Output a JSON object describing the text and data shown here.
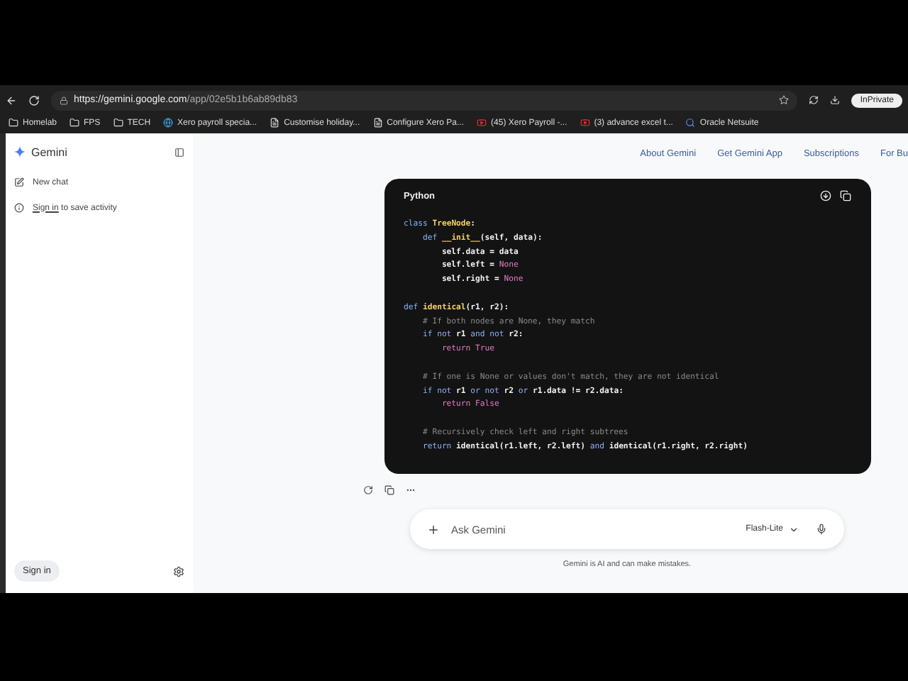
{
  "browser": {
    "url_host": "https://gemini.google.com",
    "url_path": "/app/02e5b1b6ab89db83",
    "profile": "InPrivate",
    "bookmarks": [
      {
        "label": "Homelab",
        "kind": "folder"
      },
      {
        "label": "FPS",
        "kind": "folder"
      },
      {
        "label": "TECH",
        "kind": "folder"
      },
      {
        "label": "Xero payroll specia...",
        "kind": "globe"
      },
      {
        "label": "Customise holiday...",
        "kind": "page"
      },
      {
        "label": "Configure Xero Pa...",
        "kind": "page"
      },
      {
        "label": "(45) Xero Payroll -...",
        "kind": "video"
      },
      {
        "label": "(3) advance excel t...",
        "kind": "video"
      },
      {
        "label": "Oracle Netsuite",
        "kind": "search"
      }
    ]
  },
  "sidebar": {
    "brand": "Gemini",
    "items": [
      {
        "label": "New chat",
        "kind": "new"
      },
      {
        "label": "Sign in",
        "suffix": " to save activity",
        "kind": "signin"
      }
    ],
    "sign_in_button": "Sign in"
  },
  "top_links": [
    "About Gemini",
    "Get Gemini App",
    "Subscriptions",
    "For Bu"
  ],
  "code": {
    "language": "Python",
    "lines": [
      {
        "kind": "code",
        "tokens": [
          {
            "text": "class ",
            "kind": "keyword"
          },
          {
            "text": "TreeNode",
            "kind": "name"
          },
          {
            "text": ":",
            "kind": "plain"
          }
        ]
      },
      {
        "kind": "code",
        "tokens": [
          {
            "text": "    def ",
            "kind": "keyword"
          },
          {
            "text": "__init__",
            "kind": "name"
          },
          {
            "text": "(self, data):",
            "kind": "plain"
          }
        ]
      },
      {
        "kind": "code",
        "tokens": [
          {
            "text": "        self.data = data",
            "kind": "plain"
          }
        ]
      },
      {
        "kind": "code",
        "tokens": [
          {
            "text": "        self.left = ",
            "kind": "plain"
          },
          {
            "text": "None",
            "kind": "constant"
          }
        ]
      },
      {
        "kind": "code",
        "tokens": [
          {
            "text": "        self.right = ",
            "kind": "plain"
          },
          {
            "text": "None",
            "kind": "constant"
          }
        ]
      },
      {
        "kind": "blank"
      },
      {
        "kind": "code",
        "tokens": [
          {
            "text": "def ",
            "kind": "keyword"
          },
          {
            "text": "identical",
            "kind": "name"
          },
          {
            "text": "(r1, r2):",
            "kind": "plain"
          }
        ]
      },
      {
        "kind": "code",
        "tokens": [
          {
            "text": "    # If both nodes are None, they match",
            "kind": "comment"
          }
        ]
      },
      {
        "kind": "code",
        "tokens": [
          {
            "text": "    if not ",
            "kind": "keyword"
          },
          {
            "text": "r1 ",
            "kind": "plain"
          },
          {
            "text": "and not ",
            "kind": "keyword"
          },
          {
            "text": "r2:",
            "kind": "plain"
          }
        ]
      },
      {
        "kind": "code",
        "tokens": [
          {
            "text": "        return True",
            "kind": "constant"
          }
        ]
      },
      {
        "kind": "blank"
      },
      {
        "kind": "code",
        "tokens": [
          {
            "text": "    # If one is None or values don't match, they are not identical",
            "kind": "comment"
          }
        ]
      },
      {
        "kind": "code",
        "tokens": [
          {
            "text": "    if not ",
            "kind": "keyword"
          },
          {
            "text": "r1 ",
            "kind": "plain"
          },
          {
            "text": "or not ",
            "kind": "keyword"
          },
          {
            "text": "r2 ",
            "kind": "plain"
          },
          {
            "text": "or ",
            "kind": "keyword"
          },
          {
            "text": "r1.data != r2.data:",
            "kind": "plain"
          }
        ]
      },
      {
        "kind": "code",
        "tokens": [
          {
            "text": "        return False",
            "kind": "constant"
          }
        ]
      },
      {
        "kind": "blank"
      },
      {
        "kind": "code",
        "tokens": [
          {
            "text": "    # Recursively check left and right subtrees",
            "kind": "comment"
          }
        ]
      },
      {
        "kind": "code",
        "tokens": [
          {
            "text": "    return ",
            "kind": "keyword"
          },
          {
            "text": "identical(r1.left, r2.left) ",
            "kind": "plain"
          },
          {
            "text": "and ",
            "kind": "keyword"
          },
          {
            "text": "identical(r1.right, r2.right)",
            "kind": "plain"
          }
        ]
      }
    ]
  },
  "composer": {
    "placeholder": "Ask Gemini",
    "model": "Flash-Lite"
  },
  "disclaimer": "Gemini is AI and can make mistakes."
}
